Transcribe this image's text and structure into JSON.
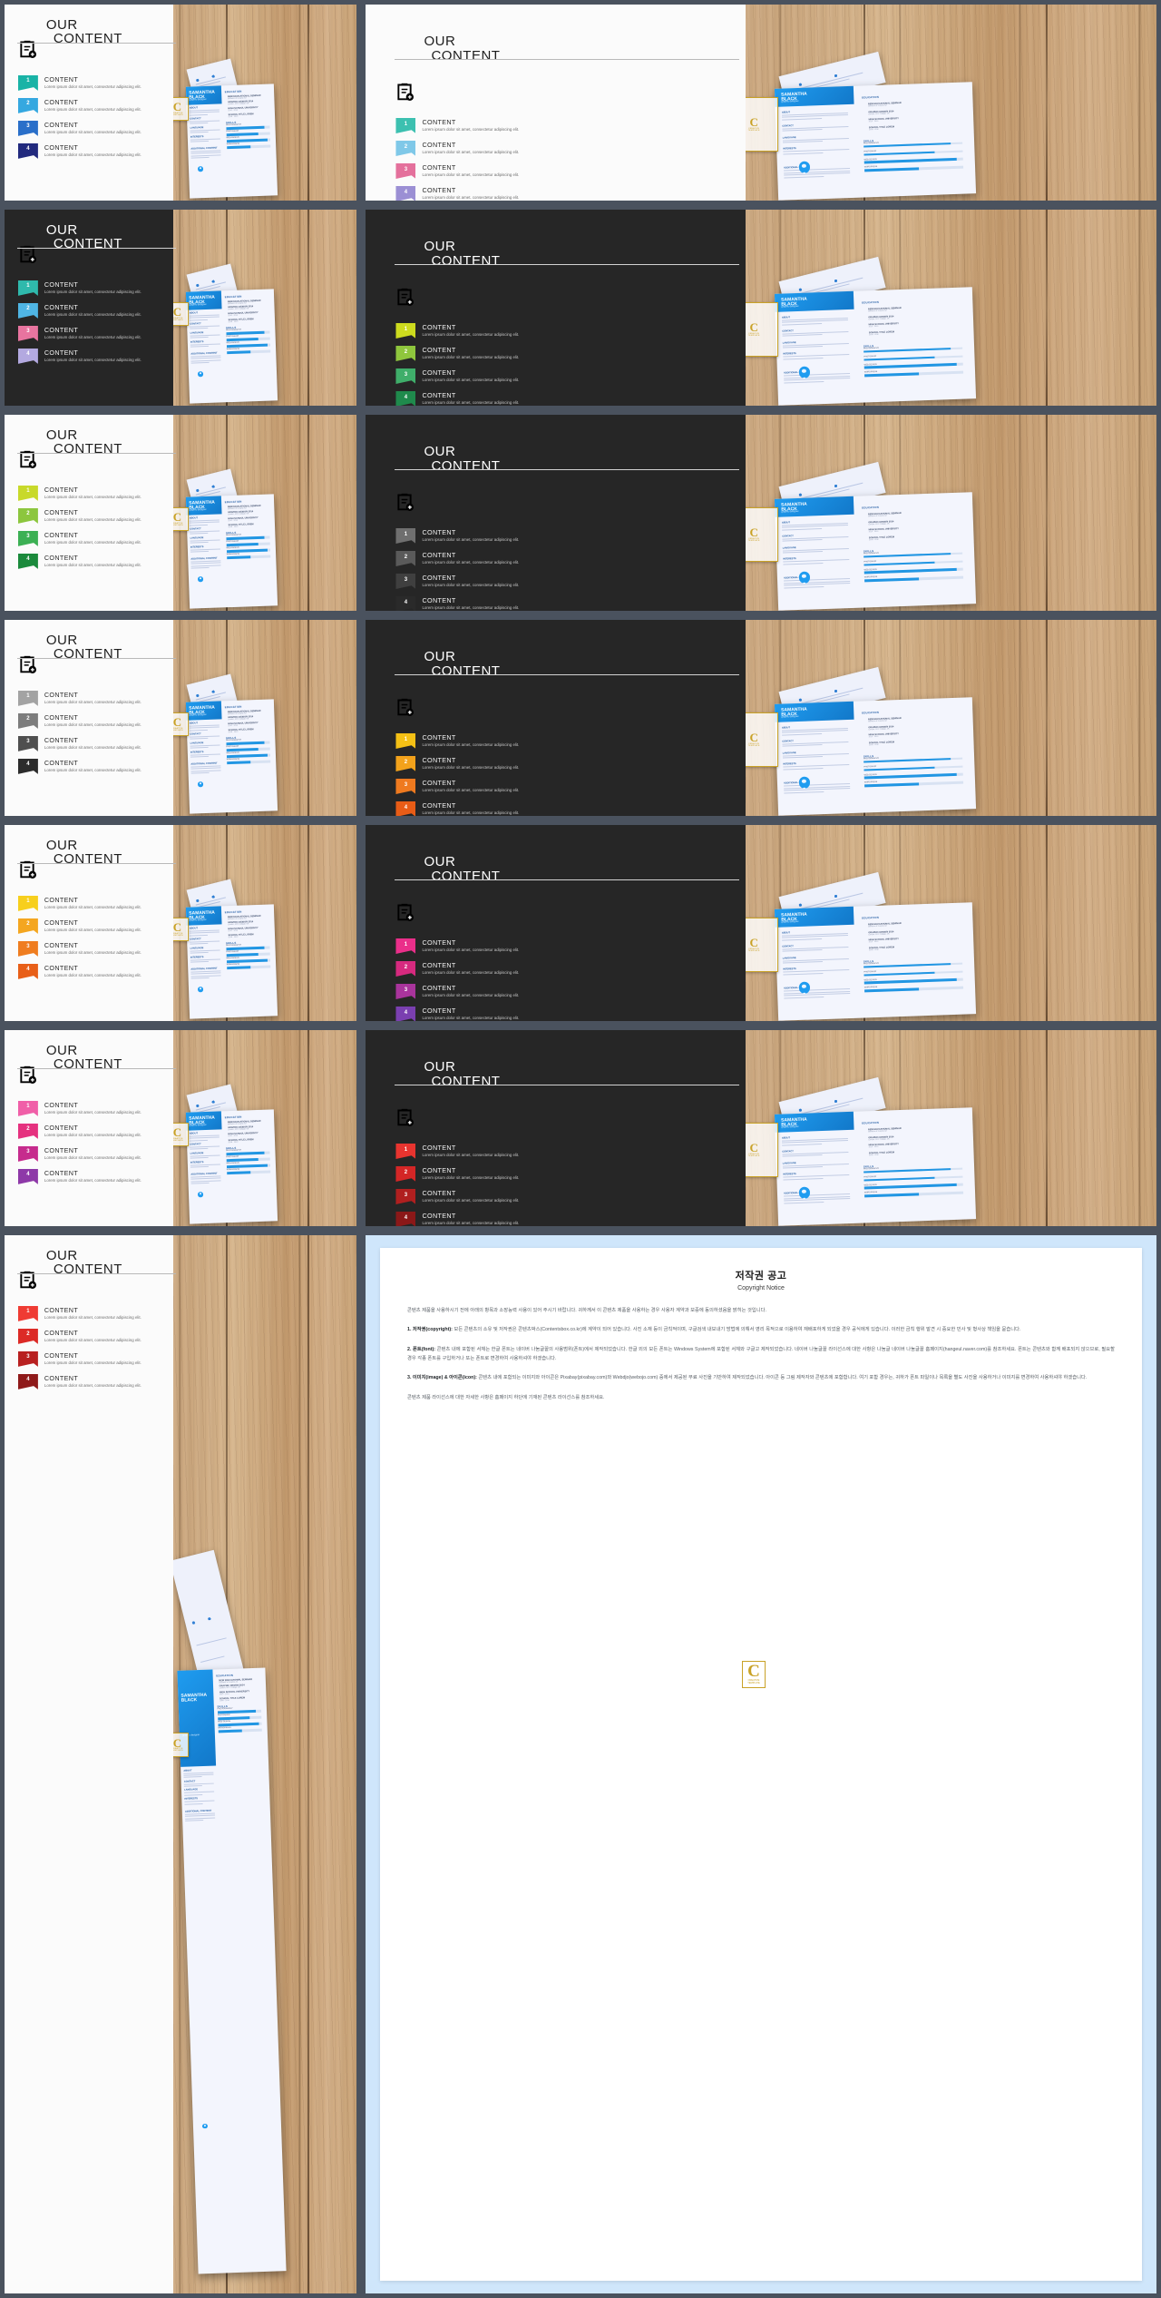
{
  "slide": {
    "title_line1": "OUR",
    "title_line2": "CONTENT",
    "icon": "clipboard-add-icon",
    "item_title": "CONTENT",
    "item_desc": "Lorem ipsum dolor sit amet, consectetur adipiscing elit.",
    "numbers": [
      "1",
      "2",
      "3",
      "4"
    ]
  },
  "resume": {
    "name_line1": "SAMANTHA",
    "name_line2": "BLACK",
    "role": "graphic designer",
    "section_education": "EDUCATION",
    "edu": [
      {
        "school": "NEW EDUCATIONAL SEMINAR",
        "note": "Bachelor of Graphic Art"
      },
      {
        "school": "GRAPHIC DESIGN 2014",
        "note": "London, NYC College, UK"
      },
      {
        "school": "HIGH SCHOOL UNIVERSITY",
        "note": "2010 - 2014"
      },
      {
        "school": "SCHOOL TITLE LOREM",
        "note": "2008 - 2010"
      }
    ],
    "section_skills": "SKILLS",
    "skills": [
      {
        "label": "PHOTOGRAPHY",
        "value": 88
      },
      {
        "label": "PHOTOSHOP",
        "value": 72
      },
      {
        "label": "WEB DESIGN",
        "value": 94
      },
      {
        "label": "WORDPRESS",
        "value": 55
      }
    ],
    "left_labels": [
      "ABOUT",
      "CONTACT",
      "LANGUAGE",
      "INTERESTS",
      "AWARDS"
    ],
    "additional": "ADDITIONAL CONTENT"
  },
  "stamp": {
    "letter": "C",
    "caption": "CREATIVE\\nTEMPLATE"
  },
  "copyright": {
    "title": "저작권 공고",
    "subtitle": "Copyright Notice",
    "intro": "콘텐츠 제품을 사용하시기 전에 아래의 항목과 소장능력 사용이 있어 주시기 바랍니다. 귀하께서 이 콘텐츠 제품을 사용하는 경우 사용자 계약과 보증에 동의하셨음을 밝히는 것입니다.",
    "paragraphs": [
      {
        "heading": "1. 저작권(copyright):",
        "text": "모든 콘텐츠의 소유 및 저작권은 콘텐츠박스(Contentsbox.co.kr)에 계약이 되어 있습니다. 사진 소재 등이 금칙적이며, 구글검색 내보내기 방법에 의해서 영리 목적으로 이용하여 재배포하게 되었을 경우 공식에게 있습니다. 이러한 금칙 행위 발견 시 중요한 민사 및 형사상 책임을 묻습니다."
      },
      {
        "heading": "2. 폰트(font):",
        "text": "콘텐츠 내에 포함된 서체는 한글 폰트는 네이버 나눔글꼴의 사용범위(폰트)에서 제작되었습니다. 한글 외의 모든 폰트는 Windows System에 포함된 서체와 구글고 제작되었습니다. 네이버 나눔글꼴 라이선스에 대한 사항은 나눔글 네이버 나눔글꼴 홈페이지(hangeul.naver.com)를 참조하세요. 폰트는 콘텐츠와 함께 배포되지 않으므로, 필요할 경우 각종 폰트를 구입하거나 또는 폰트로 변경하여 사용하셔야 하겠습니다."
      },
      {
        "heading": "3. 이미지(image) & 아이콘(icon):",
        "text": "콘텐츠 내에 포함되는 이미지와 아이콘은 Pixabay(pixabay.com)와 Webdjo(webojo.com) 중에서 제공된 무료 사진을 기반하여 제작되었습니다. 아이콘 등 그림 제작자와 콘텐츠에 포함합니다. 여기 포함 경우는, 귀하가 폰트 파일이나 목록을 별도 사진을 사용하거나 이미지를 변경하여 사용하셔야 하겠습니다."
      }
    ],
    "footer": "콘텐츠 제품 라이선스에 대한 자세한 사항은 홈페이지 하단에 기재된 콘텐츠 라이선스를 참조하세요."
  },
  "variants": [
    {
      "id": "v1",
      "theme": "light",
      "colors": [
        "#19b3a6",
        "#35a8e0",
        "#2a6fc9",
        "#222a7e"
      ]
    },
    {
      "id": "v2",
      "theme": "light",
      "colors": [
        "#3cc0b0",
        "#7fc8e8",
        "#e4709c",
        "#9b8fd4"
      ]
    },
    {
      "id": "v3",
      "theme": "dark",
      "colors": [
        "#2fb9ac",
        "#4fb5e4",
        "#e8749f",
        "#b3a9e0"
      ]
    },
    {
      "id": "v4",
      "theme": "dark",
      "colors": [
        "#cddb1e",
        "#8fc63d",
        "#3fae6a",
        "#1f8a4c"
      ]
    },
    {
      "id": "v5",
      "theme": "light",
      "colors": [
        "#c8d92a",
        "#8cc63e",
        "#3cb054",
        "#1b8a3c"
      ]
    },
    {
      "id": "v6",
      "theme": "dark",
      "colors": [
        "#6f6f6f",
        "#5a5a5a",
        "#3f3f3f",
        "#2a2a2a"
      ]
    },
    {
      "id": "v7",
      "theme": "light",
      "colors": [
        "#a3a3a3",
        "#7d7d7d",
        "#4f4f4f",
        "#2c2c2c"
      ]
    },
    {
      "id": "v8",
      "theme": "dark",
      "colors": [
        "#f4c015",
        "#f3a21b",
        "#ef7a1f",
        "#e85c16"
      ]
    },
    {
      "id": "v9",
      "theme": "light",
      "colors": [
        "#f7cf1d",
        "#f4a620",
        "#ef7d20",
        "#e85f18"
      ]
    },
    {
      "id": "v10",
      "theme": "dark",
      "colors": [
        "#ea2f8a",
        "#d62a7f",
        "#a9349c",
        "#7a3fb0"
      ]
    },
    {
      "id": "v11",
      "theme": "light",
      "colors": [
        "#f05fa8",
        "#e5317f",
        "#c62b8d",
        "#8e39a8"
      ]
    },
    {
      "id": "v12",
      "theme": "dark",
      "colors": [
        "#e8342f",
        "#d42626",
        "#b01f1f",
        "#8b1818"
      ]
    },
    {
      "id": "v13",
      "theme": "light",
      "colors": [
        "#ef3b33",
        "#dc2a26",
        "#b82020",
        "#8f1a1a"
      ]
    }
  ]
}
